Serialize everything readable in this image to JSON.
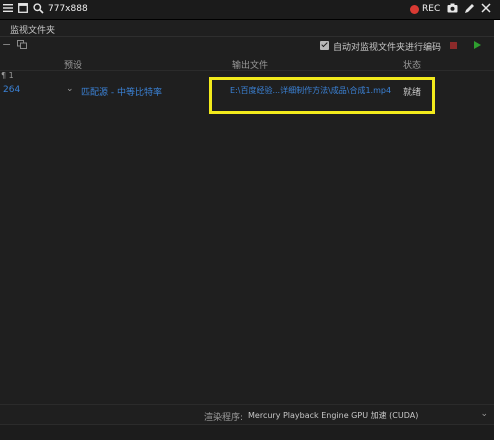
{
  "capture_bar": {
    "size_label": "777x888",
    "rec_label": "REC"
  },
  "panel": {
    "tab_title": "监视文件夹"
  },
  "toolbar": {
    "auto_encode_label": "自动对监视文件夹进行编码",
    "auto_encode_checked": true
  },
  "table": {
    "headers": {
      "preset": "预设",
      "output": "输出文件",
      "status": "状态"
    },
    "source_label": "¶ 1",
    "items": [
      {
        "format": "264",
        "preset": "匹配源 - 中等比特率",
        "output_file": "E:\\百度经验...详细制作方法\\成品\\合成1.mp4",
        "status": "就绪"
      }
    ]
  },
  "renderer": {
    "label": "渲染程序:",
    "value": "Mercury Playback Engine GPU 加速 (CUDA)"
  },
  "colors": {
    "background": "#1f1f1f",
    "link_blue": "#3b82d6",
    "highlight_yellow": "#f2ea1c",
    "rec_red": "#d93a33",
    "play_green": "#2f9e2f"
  }
}
